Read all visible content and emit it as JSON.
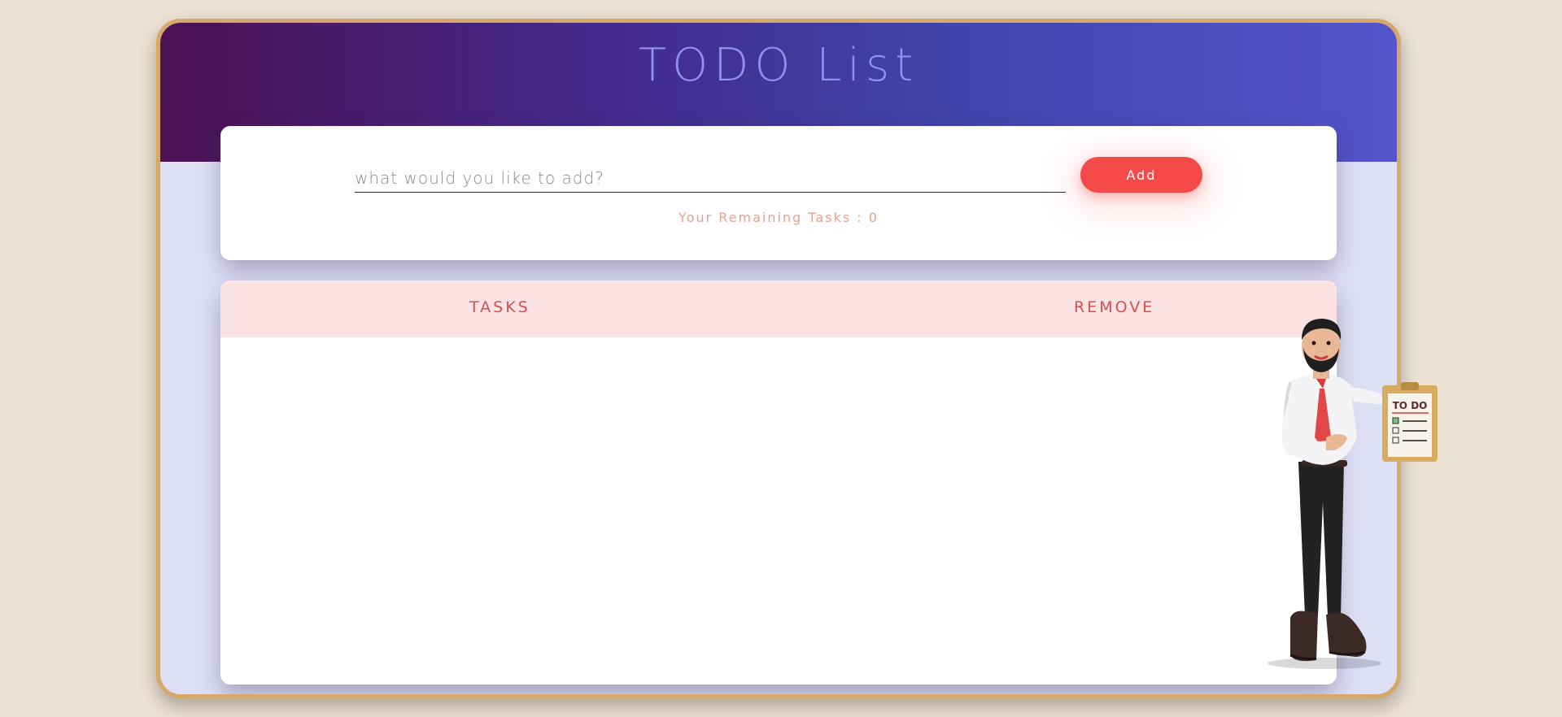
{
  "header": {
    "title": "TODO List"
  },
  "add_form": {
    "placeholder": "what would you like to add?",
    "value": "",
    "add_label": "Add",
    "remaining_label": "Your Remaining Tasks : 0"
  },
  "task_list": {
    "columns": [
      "TASKS",
      "REMOVE"
    ],
    "rows": []
  },
  "illustration": {
    "clipboard_text": "TO DO"
  },
  "colors": {
    "background": "#eee4d6",
    "frame_border": "#d6a96a",
    "header_gradient_start": "#4b1153",
    "header_gradient_end": "#5454cb",
    "title": "#8f8ff0",
    "accent": "#f44a4a",
    "list_header_bg": "#fbe3e3",
    "column_text": "#d84f4f",
    "remaining_text": "#e7a28e"
  }
}
